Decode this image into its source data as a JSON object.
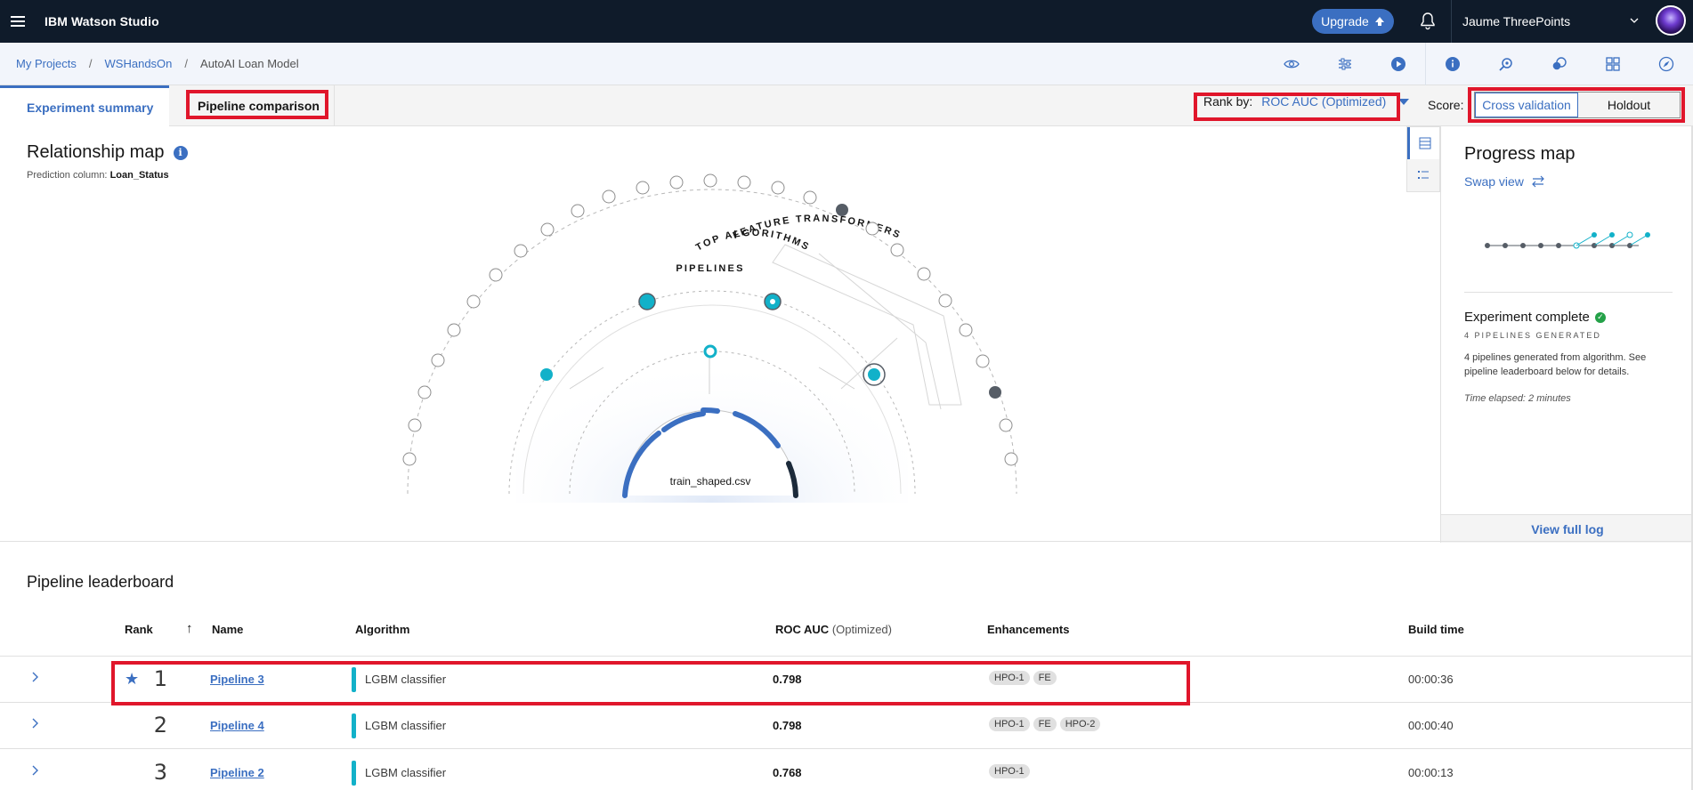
{
  "app": {
    "brand": "IBM Watson Studio",
    "upgrade_label": "Upgrade",
    "user_name": "Jaume ThreePoints"
  },
  "breadcrumb": {
    "items": [
      "My Projects",
      "WSHandsOn",
      "AutoAI Loan Model"
    ]
  },
  "tabs": {
    "summary": "Experiment summary",
    "comparison": "Pipeline comparison"
  },
  "rank_by": {
    "label": "Rank by:",
    "value": "ROC AUC (Optimized)"
  },
  "score": {
    "label": "Score:",
    "options": [
      "Cross validation",
      "Holdout"
    ],
    "selected": "Cross validation"
  },
  "relationship_map": {
    "title": "Relationship map",
    "prediction_label": "Prediction column:",
    "prediction_value": "Loan_Status",
    "ring_labels": {
      "outer": "FEATURE TRANSFORMERS",
      "middle": "PIPELINES",
      "inner": "TOP ALGORITHMS"
    },
    "center_label": "train_shaped.csv"
  },
  "progress_map": {
    "title": "Progress map",
    "swap_view": "Swap view",
    "status": "Experiment complete",
    "pipelines_generated": "4 PIPELINES GENERATED",
    "description": "4 pipelines generated from algorithm. See pipeline leaderboard below for details.",
    "time_elapsed": "Time elapsed: 2 minutes",
    "view_log": "View full log"
  },
  "leaderboard": {
    "title": "Pipeline leaderboard",
    "columns": {
      "rank": "Rank",
      "name": "Name",
      "algorithm": "Algorithm",
      "metric": "ROC AUC",
      "metric_note": "(Optimized)",
      "enhancements": "Enhancements",
      "build_time": "Build time"
    },
    "rows": [
      {
        "rank": "1",
        "starred": true,
        "name": "Pipeline 3",
        "algorithm": "LGBM classifier",
        "score": "0.798",
        "enhancements": [
          "HPO-1",
          "FE"
        ],
        "build_time": "00:00:36"
      },
      {
        "rank": "2",
        "starred": false,
        "name": "Pipeline 4",
        "algorithm": "LGBM classifier",
        "score": "0.798",
        "enhancements": [
          "HPO-1",
          "FE",
          "HPO-2"
        ],
        "build_time": "00:00:40"
      },
      {
        "rank": "3",
        "starred": false,
        "name": "Pipeline 2",
        "algorithm": "LGBM classifier",
        "score": "0.768",
        "enhancements": [
          "HPO-1"
        ],
        "build_time": "00:00:13"
      }
    ]
  },
  "colors": {
    "accent": "#3b6fc1",
    "teal": "#12b1c9",
    "highlight_box": "#e0162b",
    "topbar": "#0f1b2a"
  }
}
